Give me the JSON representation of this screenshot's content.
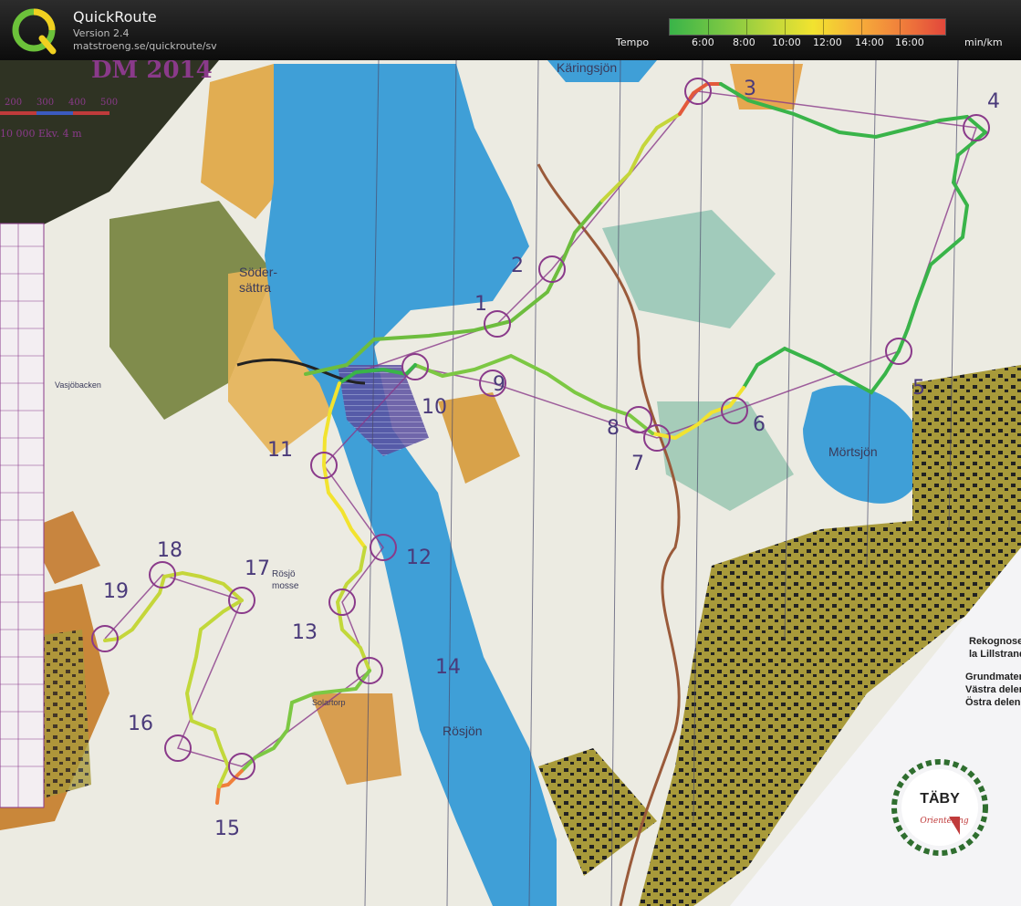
{
  "header": {
    "app_name": "QuickRoute",
    "version": "Version 2.4",
    "url": "matstroeng.se/quickroute/sv"
  },
  "legend": {
    "title": "Tempo",
    "unit": "min/km",
    "ticks": [
      "6:00",
      "8:00",
      "10:00",
      "12:00",
      "14:00",
      "16:00"
    ],
    "colors": [
      "#39b449",
      "#7cc843",
      "#c2d83a",
      "#f2e32f",
      "#f7b03a",
      "#f07f3b",
      "#e2473b"
    ]
  },
  "map": {
    "header_fragment": "DM 2014",
    "scale_text": [
      "200",
      "300",
      "400",
      "500"
    ],
    "scale_info": "10 000   Ekv. 4 m",
    "places": {
      "soder": "Söder-",
      "sattra": "sättra",
      "karingsjon": "Käringsjön",
      "mortsjon": "Mörtsjön",
      "rosjon": "Rösjön",
      "rosjomosse1": "Rösjö",
      "rosjomosse2": "mosse",
      "solartorp": "Solartorp",
      "vasjobacken": "Vasjöbacken"
    },
    "controls": [
      "1",
      "2",
      "3",
      "4",
      "5",
      "6",
      "7",
      "8",
      "9",
      "10",
      "11",
      "12",
      "13",
      "14",
      "15",
      "16",
      "17",
      "18",
      "19"
    ],
    "notes": [
      "Rekognoser",
      "la Lillstrand",
      "Grundmater",
      "Västra delen",
      "Östra delen"
    ],
    "club_logo_text": "TÄBY",
    "club_logo_sub": "Orientering"
  }
}
